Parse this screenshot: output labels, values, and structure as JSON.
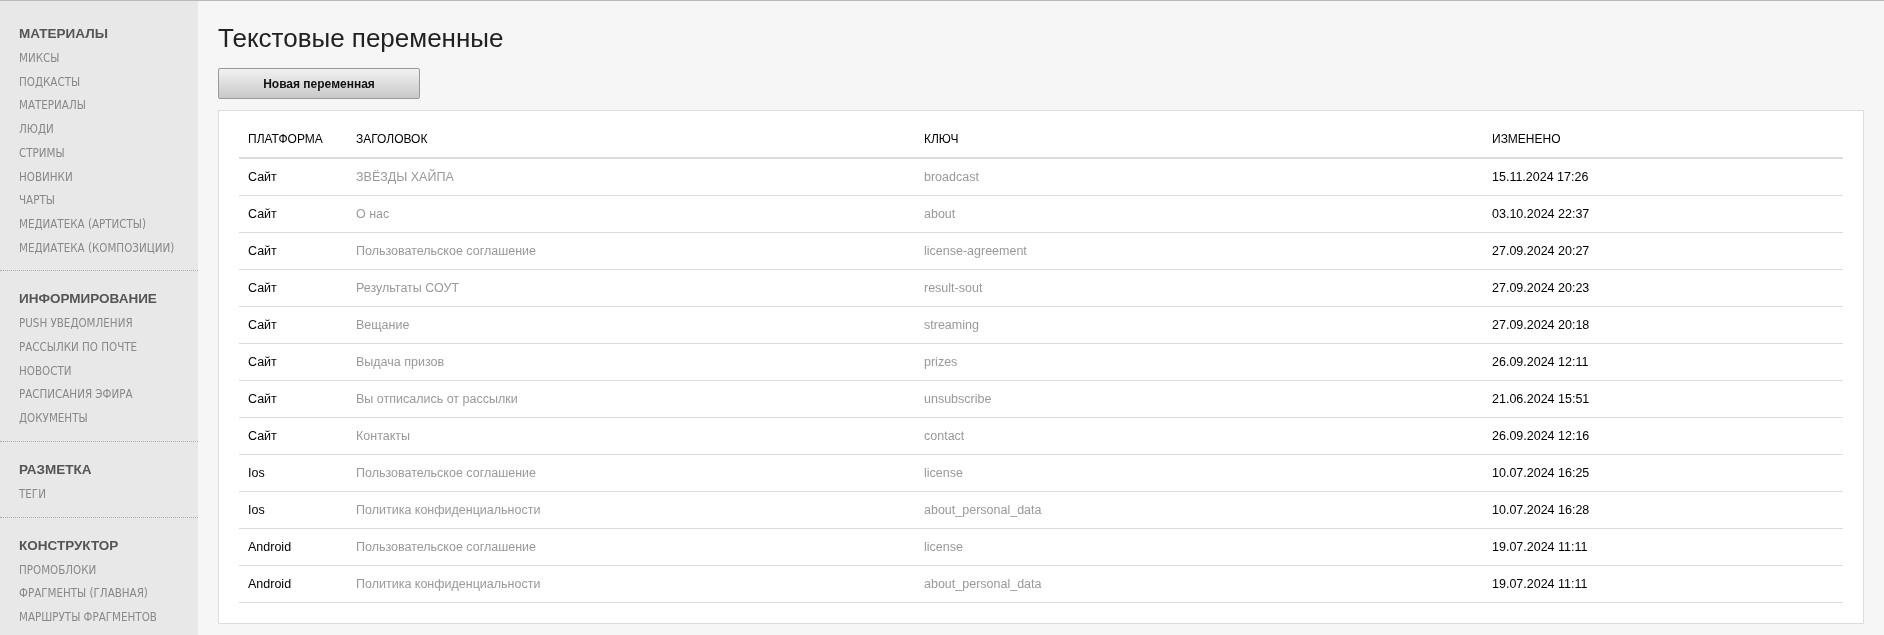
{
  "sidebar": {
    "sections": [
      {
        "title": "МАТЕРИАЛЫ",
        "items": [
          "МИКСЫ",
          "ПОДКАСТЫ",
          "МАТЕРИАЛЫ",
          "ЛЮДИ",
          "СТРИМЫ",
          "НОВИНКИ",
          "ЧАРТЫ",
          "МЕДИАТЕКА (АРТИСТЫ)",
          "МЕДИАТЕКА (КОМПОЗИЦИИ)"
        ]
      },
      {
        "title": "ИНФОРМИРОВАНИЕ",
        "items": [
          "PUSH УВЕДОМЛЕНИЯ",
          "РАССЫЛКИ ПО ПОЧТЕ",
          "НОВОСТИ",
          "РАСПИСАНИЯ ЭФИРА",
          "ДОКУМЕНТЫ"
        ]
      },
      {
        "title": "РАЗМЕТКА",
        "items": [
          "ТЕГИ"
        ]
      },
      {
        "title": "КОНСТРУКТОР",
        "items": [
          "ПРОМОБЛОКИ",
          "ФРАГМЕНТЫ (ГЛАВНАЯ)",
          "МАРШРУТЫ ФРАГМЕНТОВ"
        ]
      }
    ]
  },
  "page": {
    "title": "Текстовые переменные",
    "new_button": "Новая переменная"
  },
  "table": {
    "columns": [
      "ПЛАТФОРМА",
      "ЗАГОЛОВОК",
      "КЛЮЧ",
      "ИЗМЕНЕНО"
    ],
    "rows": [
      {
        "platform": "Сайт",
        "title": "ЗВЁЗДЫ ХАЙПА",
        "key": "broadcast",
        "modified": "15.11.2024 17:26"
      },
      {
        "platform": "Сайт",
        "title": "О нас",
        "key": "about",
        "modified": "03.10.2024 22:37"
      },
      {
        "platform": "Сайт",
        "title": "Пользовательское соглашение",
        "key": "license-agreement",
        "modified": "27.09.2024 20:27"
      },
      {
        "platform": "Сайт",
        "title": "Результаты СОУТ",
        "key": "result-sout",
        "modified": "27.09.2024 20:23"
      },
      {
        "platform": "Сайт",
        "title": "Вещание",
        "key": "streaming",
        "modified": "27.09.2024 20:18"
      },
      {
        "platform": "Сайт",
        "title": "Выдача призов",
        "key": "prizes",
        "modified": "26.09.2024 12:11"
      },
      {
        "platform": "Сайт",
        "title": "Вы отписались от рассылки",
        "key": "unsubscribe",
        "modified": "21.06.2024 15:51"
      },
      {
        "platform": "Сайт",
        "title": "Контакты",
        "key": "contact",
        "modified": "26.09.2024 12:16"
      },
      {
        "platform": "Ios",
        "title": "Пользовательское соглашение",
        "key": "license",
        "modified": "10.07.2024 16:25"
      },
      {
        "platform": "Ios",
        "title": "Политика конфиденциальности",
        "key": "about_personal_data",
        "modified": "10.07.2024 16:28"
      },
      {
        "platform": "Android",
        "title": "Пользовательское соглашение",
        "key": "license",
        "modified": "19.07.2024 11:11"
      },
      {
        "platform": "Android",
        "title": "Политика конфиденциальности",
        "key": "about_personal_data",
        "modified": "19.07.2024 11:11"
      }
    ]
  }
}
